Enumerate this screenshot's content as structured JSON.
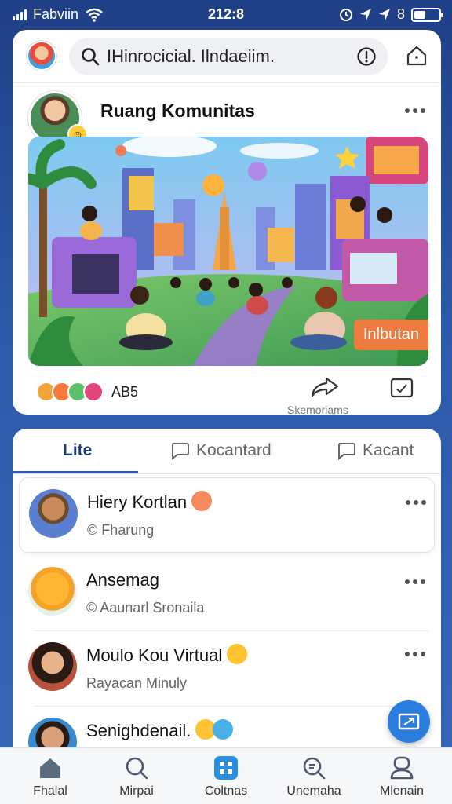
{
  "status_bar": {
    "carrier": "Fabviin",
    "time": "212:8",
    "right_glyphs": "8"
  },
  "header": {
    "search_text": "IHinrocicial. Ilndaeiim."
  },
  "post": {
    "title": "Ruang Komunitas",
    "scene_button": "Inlbutan",
    "reactions_label": "AB5",
    "share_label": "Skemoriams"
  },
  "tabs": [
    {
      "label": "Lite"
    },
    {
      "label": "Kocantard"
    },
    {
      "label": "Kacant"
    }
  ],
  "list": [
    {
      "name": "Hiery Kortlan",
      "sub": "© Fharung"
    },
    {
      "name": "Ansemag",
      "sub": "© Aaunarl Sronaila"
    },
    {
      "name": "Moulo Kou Virtual",
      "sub": "Rayacan Minuly"
    },
    {
      "name": "Senighdenail.",
      "sub": ""
    }
  ],
  "bottom_nav": [
    {
      "label": "Fhalal",
      "icon": "home-icon"
    },
    {
      "label": "Mirpai",
      "icon": "search-icon"
    },
    {
      "label": "Coltnas",
      "icon": "grid-app-icon"
    },
    {
      "label": "Unemaha",
      "icon": "chat-search-icon"
    },
    {
      "label": "Mlenain",
      "icon": "profile-icon"
    }
  ],
  "colors": {
    "accent": "#2a5db8",
    "fab": "#2a7ee0",
    "scene_button": "#f07b3f"
  }
}
